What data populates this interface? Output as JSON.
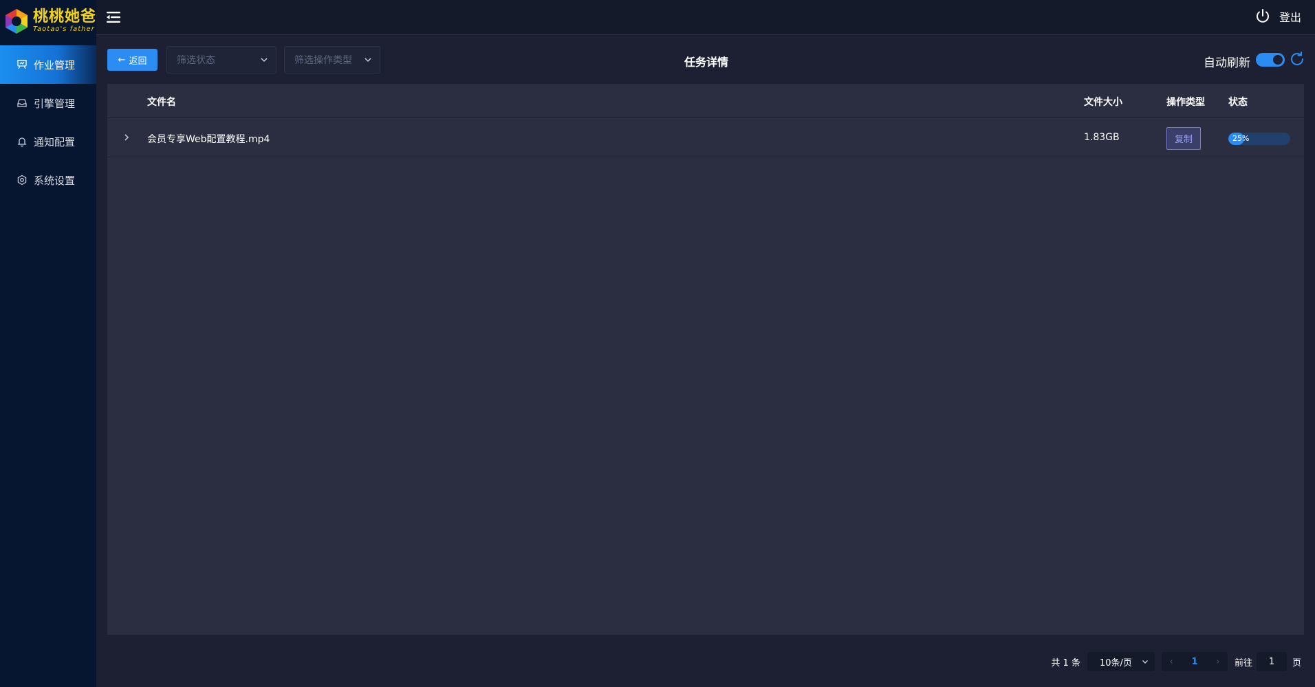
{
  "logo": {
    "main": "桃桃她爸",
    "sub": "Taotao's father"
  },
  "sidebar": {
    "items": [
      {
        "label": "作业管理",
        "icon": "presentation-icon",
        "active": true
      },
      {
        "label": "引擎管理",
        "icon": "inbox-icon",
        "active": false
      },
      {
        "label": "通知配置",
        "icon": "bell-icon",
        "active": false
      },
      {
        "label": "系统设置",
        "icon": "gear-icon",
        "active": false
      }
    ]
  },
  "header": {
    "logout_label": "登出"
  },
  "toolbar": {
    "back_label": "返回",
    "status_placeholder": "筛选状态",
    "type_placeholder": "筛选操作类型",
    "title": "任务详情",
    "auto_refresh_label": "自动刷新",
    "auto_refresh_on": true
  },
  "table": {
    "columns": {
      "name": "文件名",
      "size": "文件大小",
      "op_type": "操作类型",
      "status": "状态"
    },
    "rows": [
      {
        "name": "会员专享Web配置教程.mp4",
        "size": "1.83GB",
        "op_type": "复制",
        "progress": 25,
        "progress_text": "25%"
      }
    ]
  },
  "pagination": {
    "total_text": "共 1 条",
    "page_size": "10条/页",
    "current_page": "1",
    "goto_label": "前往",
    "goto_value": "1",
    "page_suffix": "页"
  },
  "colors": {
    "accent": "#2b8df2",
    "sidebar_bg": "#061630",
    "content_bg": "#1c2032",
    "table_bg": "#2a2e40",
    "logo": "#f3d21a"
  }
}
